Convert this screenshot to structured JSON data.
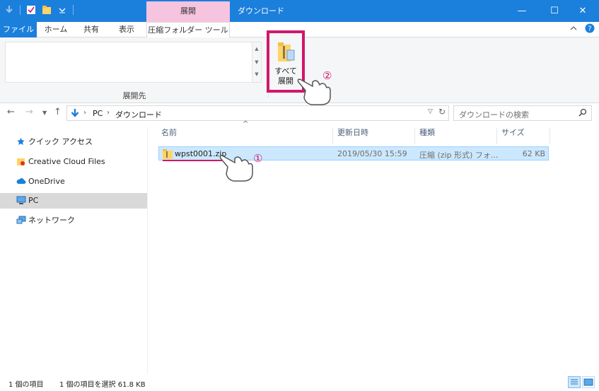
{
  "window": {
    "title": "ダウンロード",
    "context_tab": "展開"
  },
  "ribbon_tabs": {
    "file": "ファイル",
    "home": "ホーム",
    "share": "共有",
    "view": "表示",
    "compressed_tools": "圧縮フォルダー ツール"
  },
  "ribbon": {
    "group_label": "展開先",
    "extract_all_line1": "すべて",
    "extract_all_line2": "展開"
  },
  "address": {
    "root": "PC",
    "current": "ダウンロード",
    "search_placeholder": "ダウンロードの検索"
  },
  "sidebar": {
    "items": [
      {
        "label": "クイック アクセス",
        "icon": "star-icon"
      },
      {
        "label": "Creative Cloud Files",
        "icon": "creative-cloud-icon"
      },
      {
        "label": "OneDrive",
        "icon": "cloud-icon"
      },
      {
        "label": "PC",
        "icon": "computer-icon"
      },
      {
        "label": "ネットワーク",
        "icon": "network-icon"
      }
    ]
  },
  "columns": {
    "name": "名前",
    "modified": "更新日時",
    "type": "種類",
    "size": "サイズ"
  },
  "files": [
    {
      "name": "wpst0001.zip",
      "modified": "2019/05/30 15:59",
      "type": "圧縮 (zip 形式) フォ...",
      "size": "62 KB"
    }
  ],
  "status": {
    "item_count": "1 個の項目",
    "selection": "1 個の項目を選択  61.8 KB"
  },
  "callouts": {
    "step1": "①",
    "step2": "②"
  },
  "colors": {
    "accent": "#1b7fdc",
    "context_tab": "#f6c4de",
    "highlight": "#d1176a",
    "selection": "#cce8ff"
  }
}
